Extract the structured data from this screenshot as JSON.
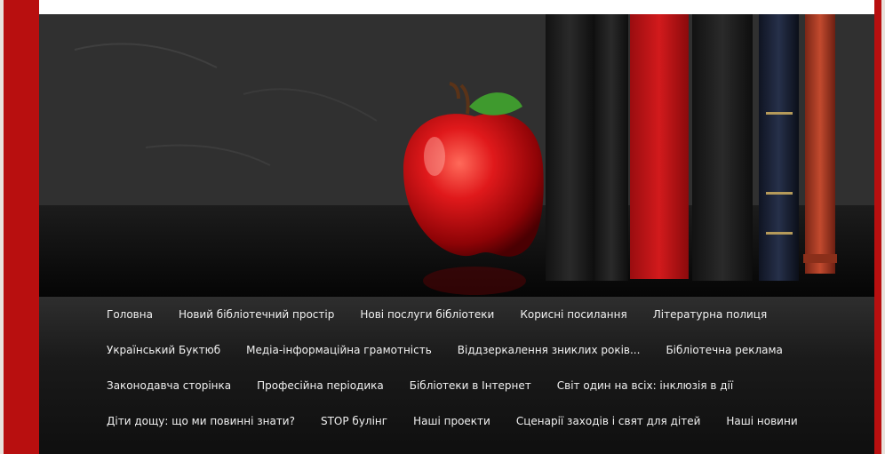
{
  "nav": {
    "rows": [
      [
        "Головна",
        "Новий бібліотечний простір",
        "Нові послуги бібліотеки",
        "Корисні посилання",
        "Літературна полиця"
      ],
      [
        "Український Буктюб",
        "Медіа-інформаційна грамотність",
        "Віддзеркалення зниклих років...",
        "Бібліотечна реклама"
      ],
      [
        "Законодавча сторінка",
        "Професійна періодика",
        "Бібліотеки в Інтернет",
        "Світ один на всіх: інклюзія в дії"
      ],
      [
        "Діти дощу: що ми повинні знати?",
        "STOP булінг",
        "Наші проекти",
        "Сценарії заходів і свят для дітей",
        "Наші новини"
      ]
    ]
  }
}
